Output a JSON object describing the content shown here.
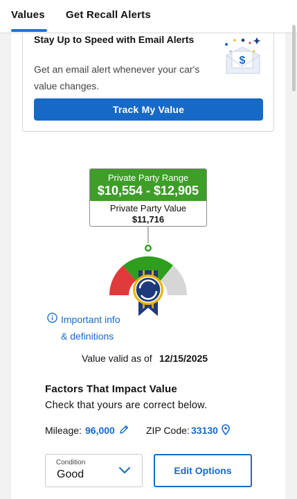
{
  "tabs": [
    {
      "label": "Values",
      "active": true
    },
    {
      "label": "Get Recall Alerts",
      "active": false
    }
  ],
  "email_card": {
    "title": "Stay Up to Speed with Email Alerts",
    "description": "Get an email alert whenever your car's value changes.",
    "button_label": "Track My Value",
    "icon": "envelope-dollar-icon"
  },
  "valuation": {
    "range_label": "Private Party Range",
    "range_value": "$10,554 - $12,905",
    "value_label": "Private Party Value",
    "value": "$11,716",
    "gauge_icon": "ribbon-award-icon"
  },
  "info": {
    "line1": "Important info",
    "line2": "& definitions",
    "icon": "info-circle-icon"
  },
  "valid_as_of": {
    "label": "Value valid as of",
    "date": "12/15/2025"
  },
  "factors": {
    "title": "Factors That Impact Value",
    "subtitle": "Check that yours are correct below.",
    "mileage_label": "Mileage:",
    "mileage_value": "96,000",
    "zip_label": "ZIP Code:",
    "zip_value": "33130"
  },
  "condition": {
    "label": "Condition",
    "value": "Good"
  },
  "edit_button_label": "Edit Options",
  "colors": {
    "accent_blue": "#1769c7",
    "range_green": "#3f9d2a",
    "gauge_red": "#e03a3a",
    "gauge_green": "#2f9e1f",
    "gauge_gray": "#d6d6d6",
    "ribbon_navy": "#1d3a7a",
    "ribbon_gold": "#e8b400"
  }
}
